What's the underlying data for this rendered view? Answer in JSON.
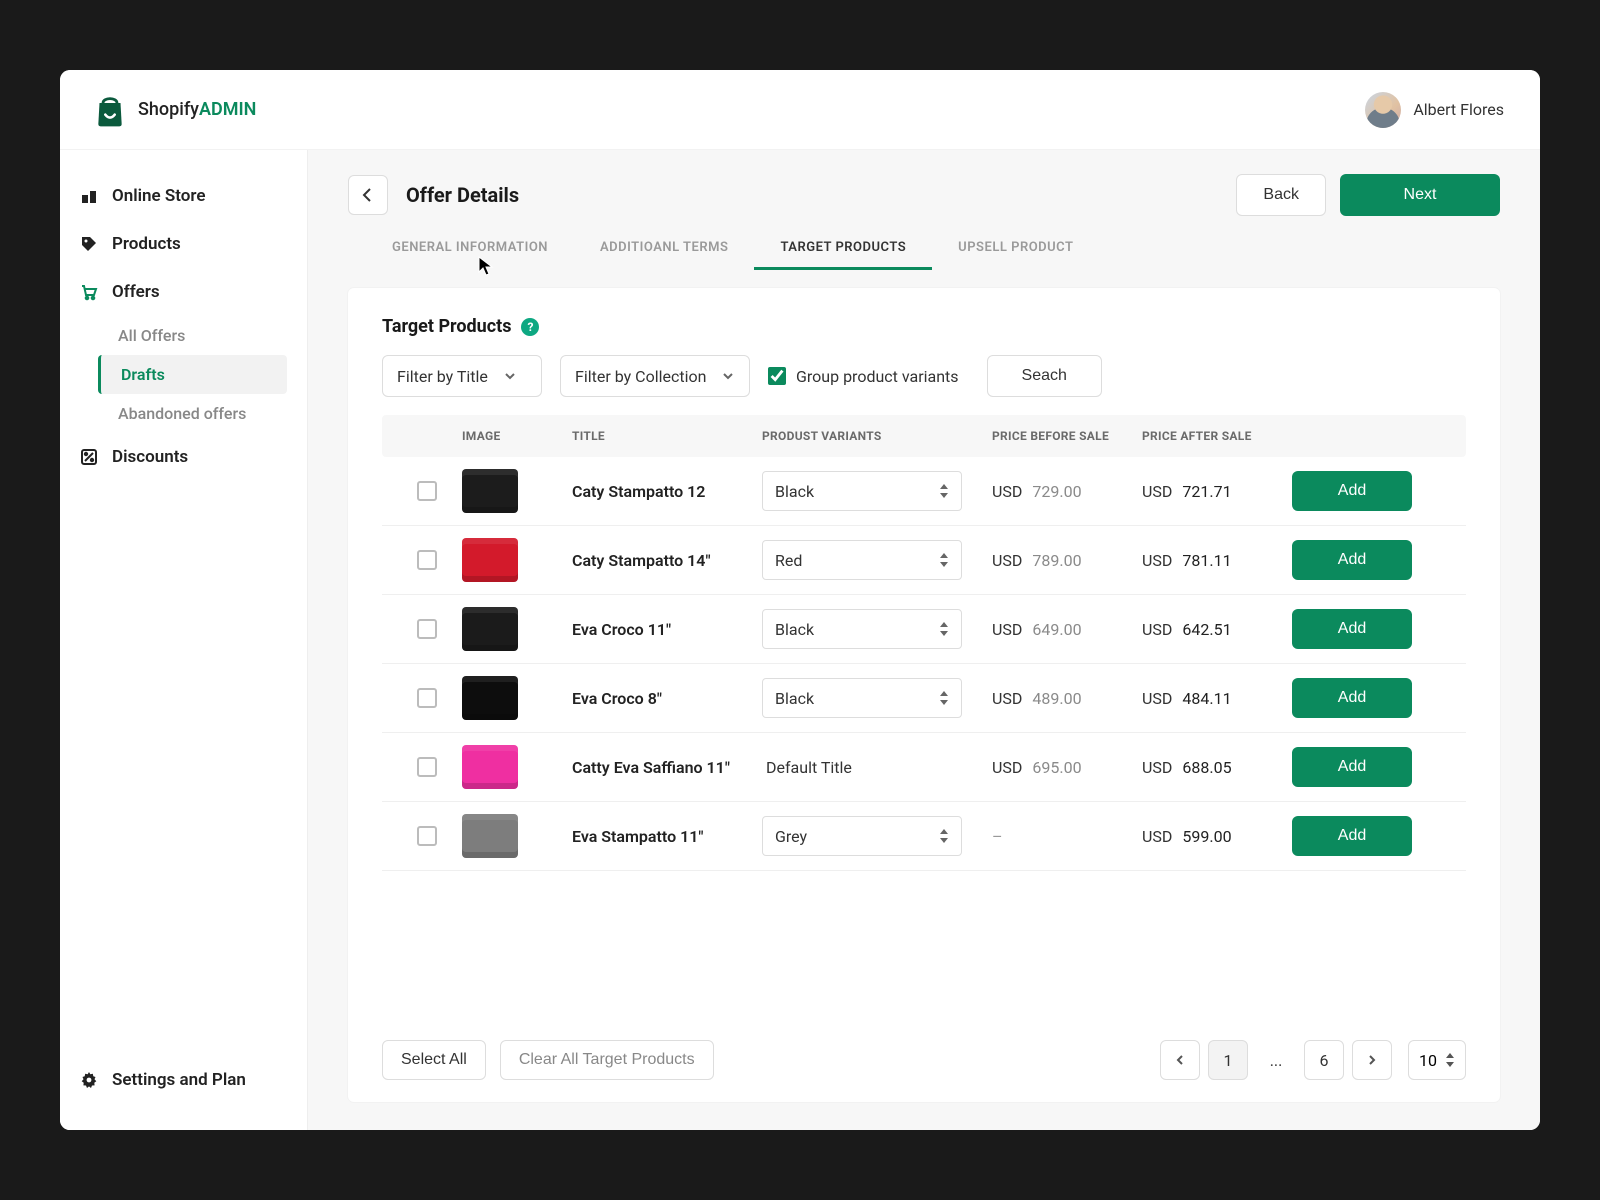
{
  "brand": {
    "name1": "Shopify",
    "name2": "ADMIN"
  },
  "user": {
    "name": "Albert Flores"
  },
  "sidebar": {
    "items": [
      {
        "label": "Online Store",
        "icon": "store-icon"
      },
      {
        "label": "Products",
        "icon": "tag-icon"
      },
      {
        "label": "Offers",
        "icon": "cart-icon",
        "active": true
      },
      {
        "label": "Discounts",
        "icon": "percent-icon"
      }
    ],
    "offers_sub": [
      {
        "label": "All Offers"
      },
      {
        "label": "Drafts",
        "active": true
      },
      {
        "label": "Abandoned offers"
      }
    ],
    "settings": {
      "label": "Settings and Plan"
    }
  },
  "page": {
    "title": "Offer Details",
    "back_label": "Back",
    "next_label": "Next"
  },
  "tabs": [
    {
      "label": "GENERAL INFORMATION"
    },
    {
      "label": "ADDITIOANL TERMS"
    },
    {
      "label": "TARGET PRODUCTS",
      "active": true
    },
    {
      "label": "UPSELL PRODUCT"
    }
  ],
  "section": {
    "title": "Target Products",
    "filter_title_label": "Filter by Title",
    "filter_collection_label": "Filter by Collection",
    "group_variants_label": "Group product variants",
    "search_label": "Seach"
  },
  "columns": {
    "image": "IMAGE",
    "title": "TITLE",
    "variants": "PRODUST VARIANTS",
    "price_before": "PRICE BEFORE SALE",
    "price_after": "PRICE AFTER SALE"
  },
  "currency": "USD",
  "add_label": "Add",
  "rows": [
    {
      "title": "Caty Stampatto 12",
      "variant": "Black",
      "variant_select": true,
      "price_before": "729.00",
      "price_after": "721.71",
      "swatch": "#1c1c1c"
    },
    {
      "title": "Caty Stampatto 14\"",
      "variant": "Red",
      "variant_select": true,
      "price_before": "789.00",
      "price_after": "781.11",
      "swatch": "#d31a2b"
    },
    {
      "title": "Eva Croco 11\"",
      "variant": "Black",
      "variant_select": true,
      "price_before": "649.00",
      "price_after": "642.51",
      "swatch": "#1b1b1b"
    },
    {
      "title": "Eva Croco 8\"",
      "variant": "Black",
      "variant_select": true,
      "price_before": "489.00",
      "price_after": "484.11",
      "swatch": "#0d0d0d"
    },
    {
      "title": "Catty Eva Saffiano 11\"",
      "variant": "Default Title",
      "variant_select": false,
      "price_before": "695.00",
      "price_after": "688.05",
      "swatch": "#ef2fa1"
    },
    {
      "title": "Eva Stampatto 11\"",
      "variant": "Grey",
      "variant_select": true,
      "price_before": "",
      "price_after": "599.00",
      "swatch": "#7d7d7d"
    }
  ],
  "footer": {
    "select_all": "Select All",
    "clear_all": "Clear All Target Products",
    "page_current": "1",
    "page_last": "6",
    "ellipsis": "...",
    "page_size": "10"
  }
}
